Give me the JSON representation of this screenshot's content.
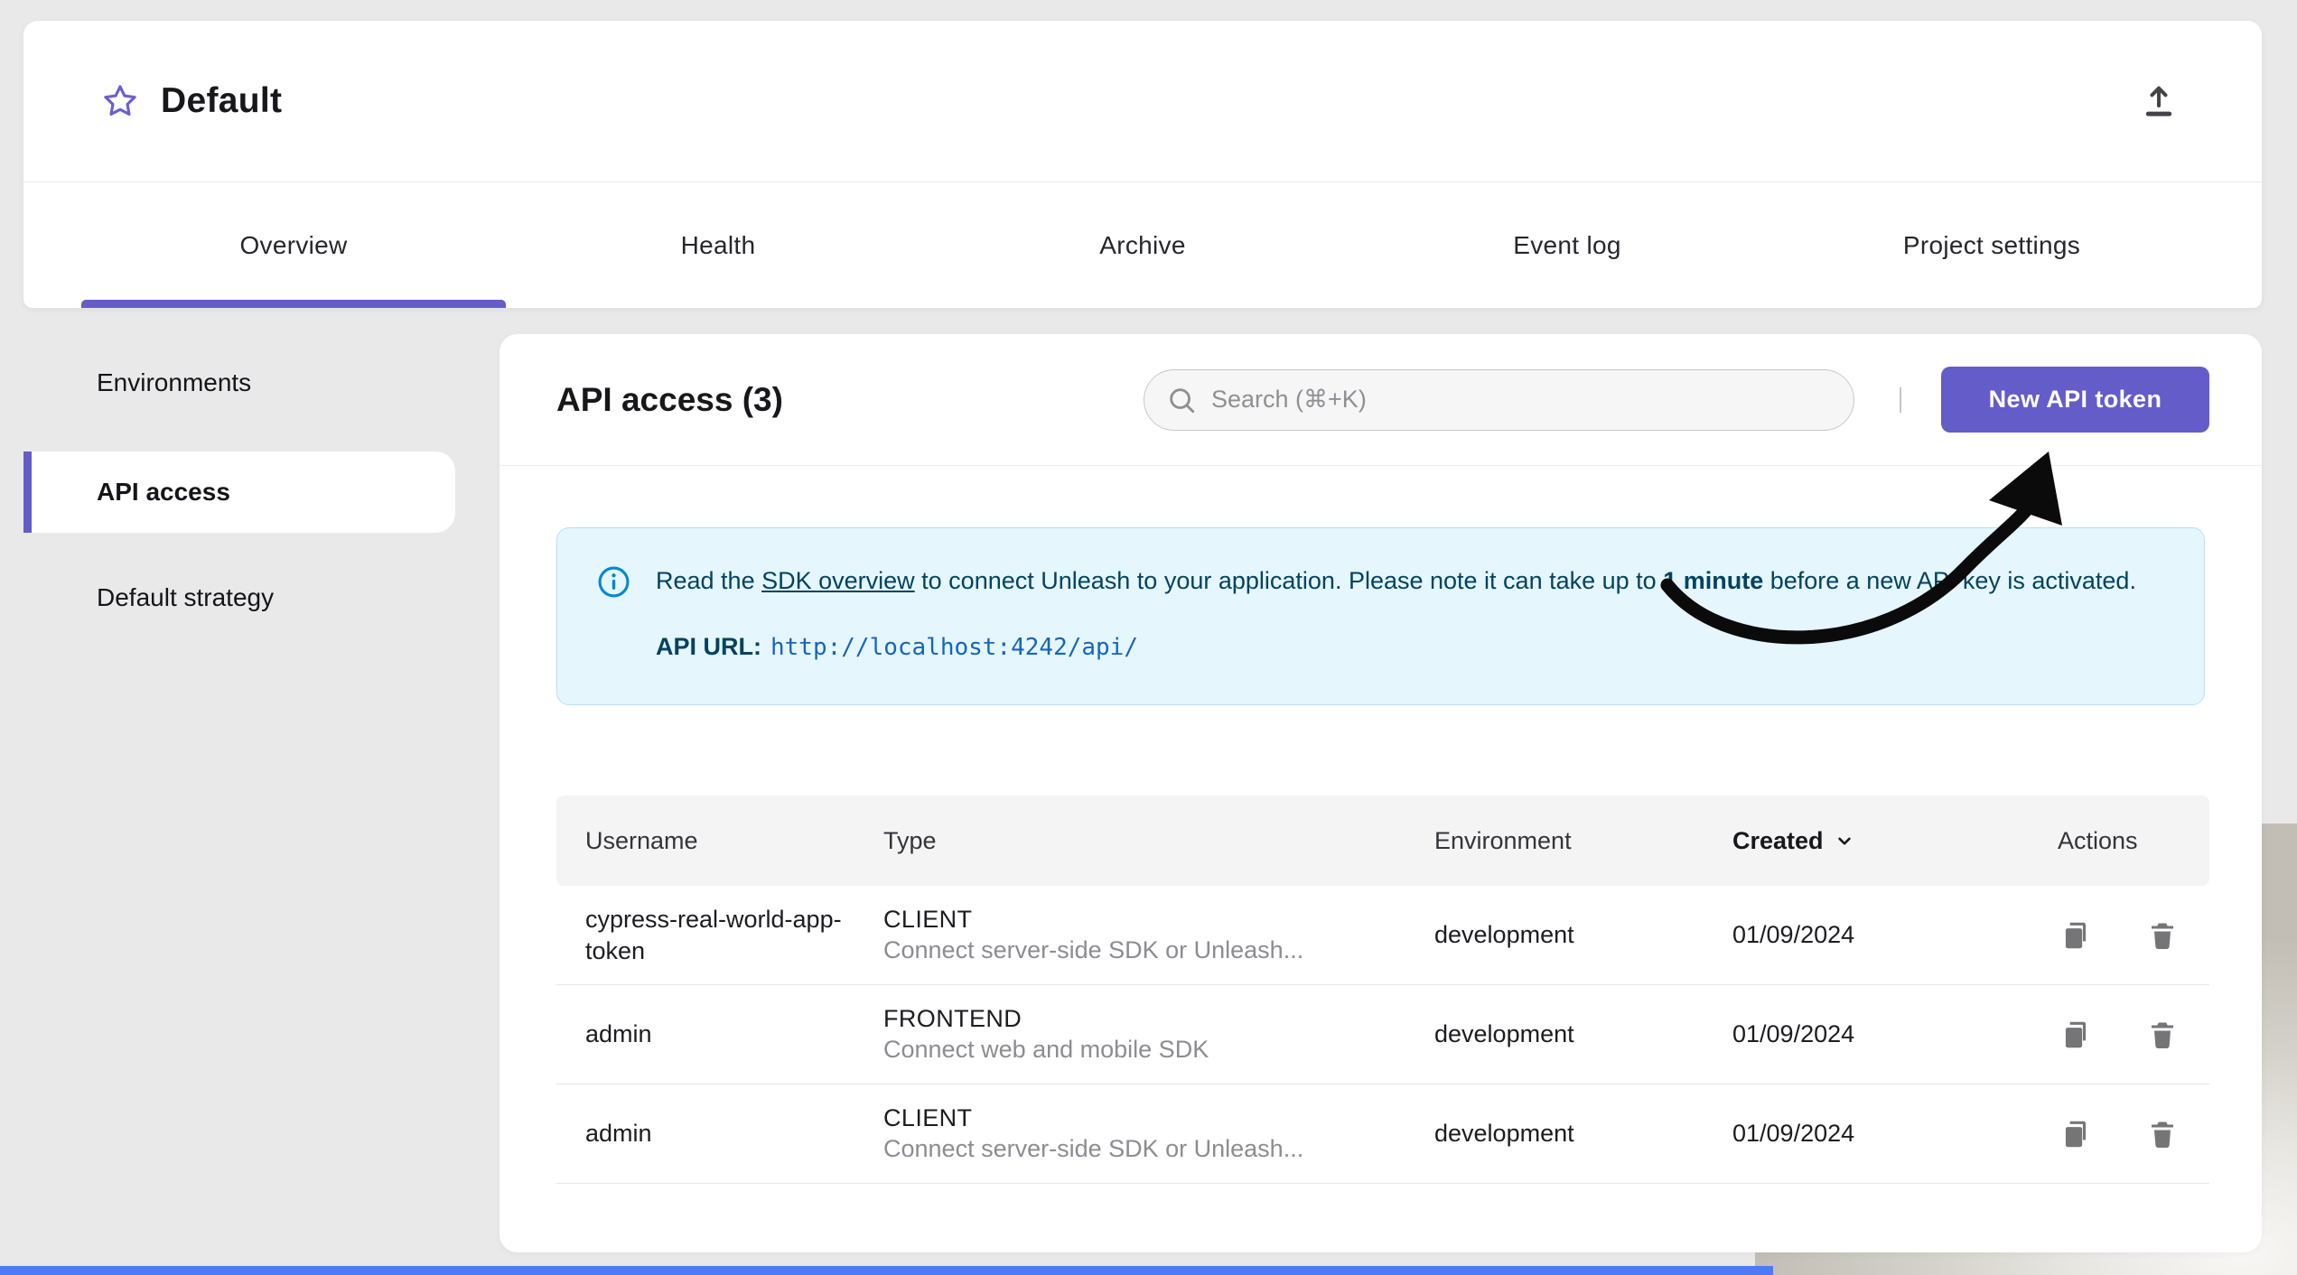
{
  "header": {
    "title": "Default"
  },
  "tabs": [
    {
      "label": "Overview",
      "active": true
    },
    {
      "label": "Health",
      "active": false
    },
    {
      "label": "Archive",
      "active": false
    },
    {
      "label": "Event log",
      "active": false
    },
    {
      "label": "Project settings",
      "active": false
    }
  ],
  "sidebar": {
    "items": [
      {
        "label": "Environments",
        "active": false
      },
      {
        "label": "API access",
        "active": true
      },
      {
        "label": "Default strategy",
        "active": false
      }
    ]
  },
  "main": {
    "title": "API access (3)",
    "search": {
      "placeholder": "Search (⌘+K)"
    },
    "new_token_button": "New API token",
    "alert": {
      "read_the": "Read the ",
      "sdk_link": "SDK overview",
      "middle": " to connect Unleash to your application. Please note it can take up to ",
      "one_minute": "1 minute",
      "end": " before a new API key is activated.",
      "api_url_label": "API URL:",
      "api_url": "http://localhost:4242/api/"
    },
    "table": {
      "headers": {
        "username": "Username",
        "type": "Type",
        "environment": "Environment",
        "created": "Created",
        "actions": "Actions"
      },
      "rows": [
        {
          "username": "cypress-real-world-app-token",
          "type": "CLIENT",
          "type_desc": "Connect server-side SDK or Unleash...",
          "environment": "development",
          "created": "01/09/2024"
        },
        {
          "username": "admin",
          "type": "FRONTEND",
          "type_desc": "Connect web and mobile SDK",
          "environment": "development",
          "created": "01/09/2024"
        },
        {
          "username": "admin",
          "type": "CLIENT",
          "type_desc": "Connect server-side SDK or Unleash...",
          "environment": "development",
          "created": "01/09/2024"
        }
      ]
    }
  },
  "colors": {
    "accent_purple": "#635CC9",
    "info_background": "#E5F6FD",
    "info_text": "#014361",
    "info_icon": "#0288D1",
    "bottom_bar_blue": "#4C7CF4"
  }
}
